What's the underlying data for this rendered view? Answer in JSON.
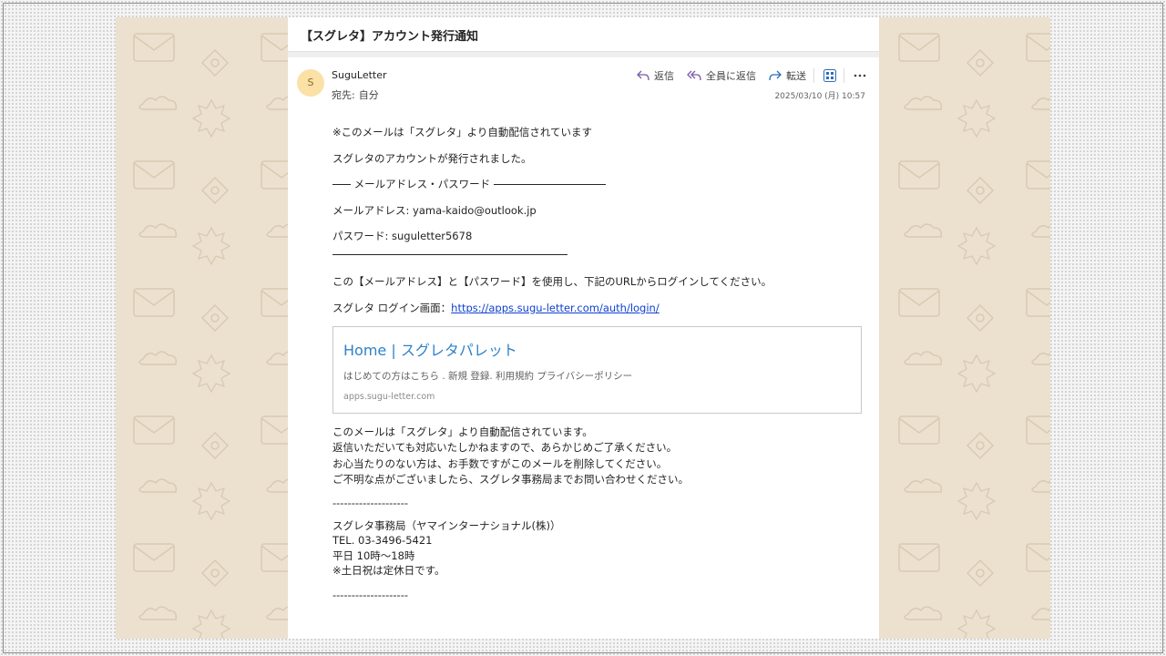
{
  "subject": "【スグレタ】アカウント発行通知",
  "sender": {
    "initial": "S",
    "name": "SuguLetter",
    "to_label": "宛先:",
    "to_value": "自分"
  },
  "actions": {
    "reply": "返信",
    "reply_all": "全員に返信",
    "forward": "転送"
  },
  "date": "2025/03/10 (月) 10:57",
  "body": {
    "line1": "※このメールは「スグレタ」より自動配信されています",
    "line2": "スグレタのアカウントが発行されました。",
    "section_heading": "メールアドレス・パスワード",
    "email_label": "メールアドレス:",
    "email_value": "yama-kaido@outlook.jp",
    "password_label": "パスワード:",
    "password_value": "suguletter5678",
    "instruction": "この【メールアドレス】と【パスワード】を使用し、下記のURLからログインしてください。",
    "login_label": "スグレタ ログイン画面：",
    "login_url": "https://apps.sugu-letter.com/auth/login/"
  },
  "link_card": {
    "title": "Home | スグレタパレット",
    "description": "はじめての方はこちら . 新規 登録. 利用規約 プライバシーポリシー",
    "domain": "apps.sugu-letter.com"
  },
  "notice": [
    "このメールは「スグレタ」より自動配信されています。",
    "返信いただいても対応いたしかねますので、あらかじめご了承ください。",
    "お心当たりのない方は、お手数ですがこのメールを削除してください。",
    "ご不明な点がございましたら、スグレタ事務局までお問い合わせください。"
  ],
  "dashes": "--------------------",
  "footer": [
    "スグレタ事務局（ヤマインターナショナル(株)）",
    "TEL. 03-3496-5421",
    "平日 10時〜18時",
    "※土日祝は定休日です。"
  ],
  "colors": {
    "wallpaper": "#ece1cf",
    "avatar_bg": "#fbe1a6",
    "link": "#0f3fd1",
    "card_title": "#2f82c7"
  }
}
